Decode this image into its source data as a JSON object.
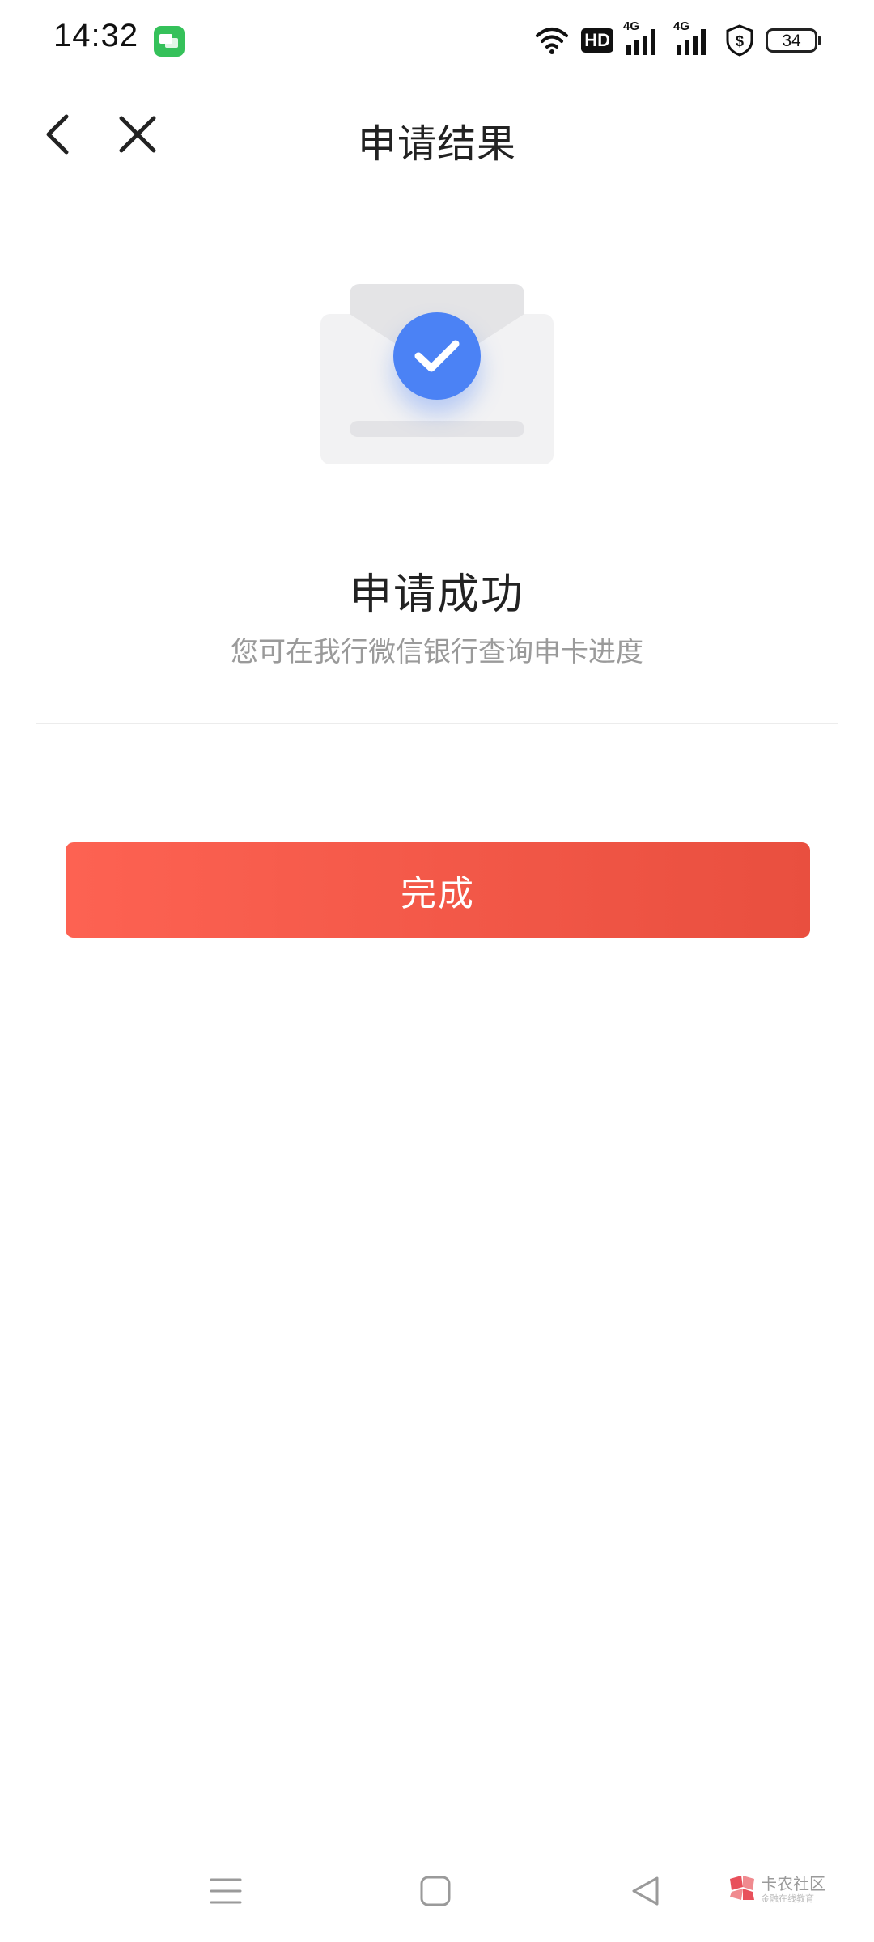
{
  "status_bar": {
    "time": "14:32",
    "hd_label": "HD",
    "network_1": "4G",
    "network_2": "4G",
    "battery": "34"
  },
  "nav": {
    "title": "申请结果"
  },
  "result": {
    "title": "申请成功",
    "subtitle": "您可在我行微信银行查询申卡进度"
  },
  "actions": {
    "done_label": "完成"
  },
  "colors": {
    "accent_red": "#f0584a",
    "check_blue": "#4b82f5",
    "subtitle_gray": "#9a9a9a"
  },
  "watermark": {
    "title": "卡农社区",
    "subtitle": "金融在线教育"
  }
}
